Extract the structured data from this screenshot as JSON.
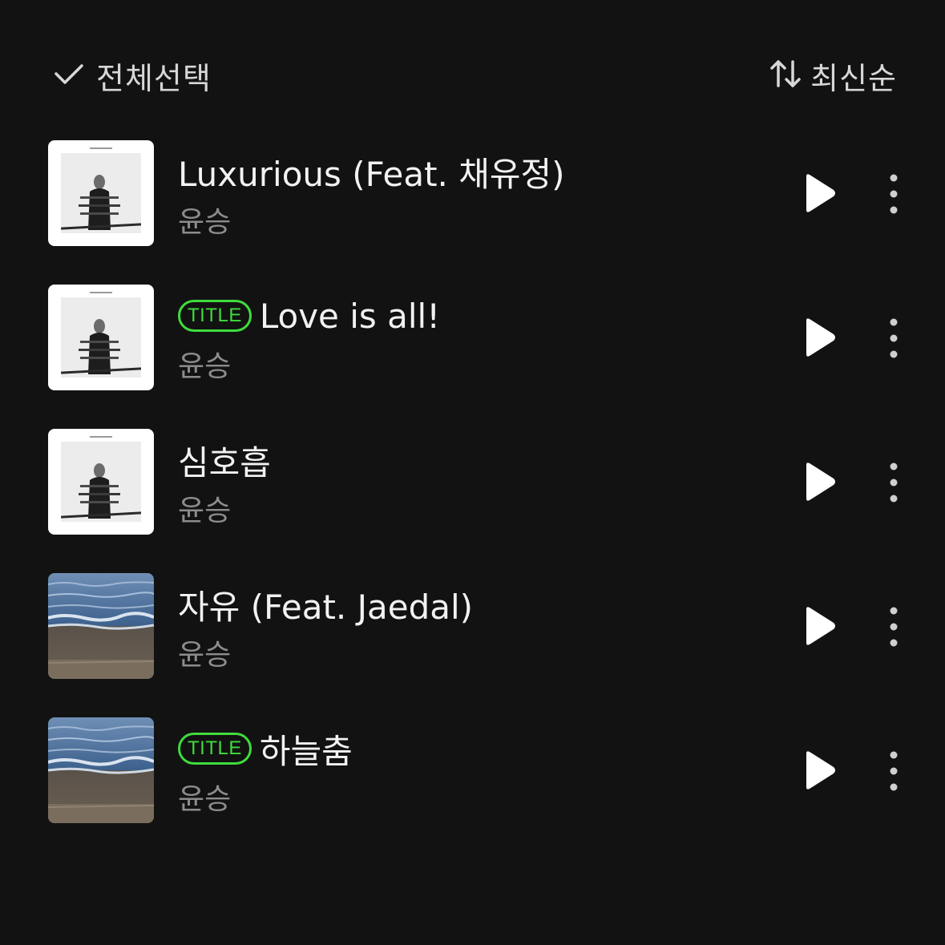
{
  "header": {
    "select_all_label": "전체선택",
    "sort_label": "최신순",
    "select_icon": "check-icon",
    "sort_icon": "sort-arrows-icon"
  },
  "colors": {
    "background": "#121212",
    "title_badge": "#3fdc3c",
    "artist_text": "#8c8c8c"
  },
  "tracks": [
    {
      "title": "Luxurious (Feat. 채유정)",
      "artist": "윤승",
      "badge": "",
      "cover": "portrait-cover"
    },
    {
      "title": "Love is all!",
      "artist": "윤승",
      "badge": "TITLE",
      "cover": "portrait-cover"
    },
    {
      "title": "심호흡",
      "artist": "윤승",
      "badge": "",
      "cover": "portrait-cover"
    },
    {
      "title": "자유 (Feat. Jaedal)",
      "artist": "윤승",
      "badge": "",
      "cover": "sea-cover"
    },
    {
      "title": "하늘춤",
      "artist": "윤승",
      "badge": "TITLE",
      "cover": "sea-cover"
    }
  ]
}
